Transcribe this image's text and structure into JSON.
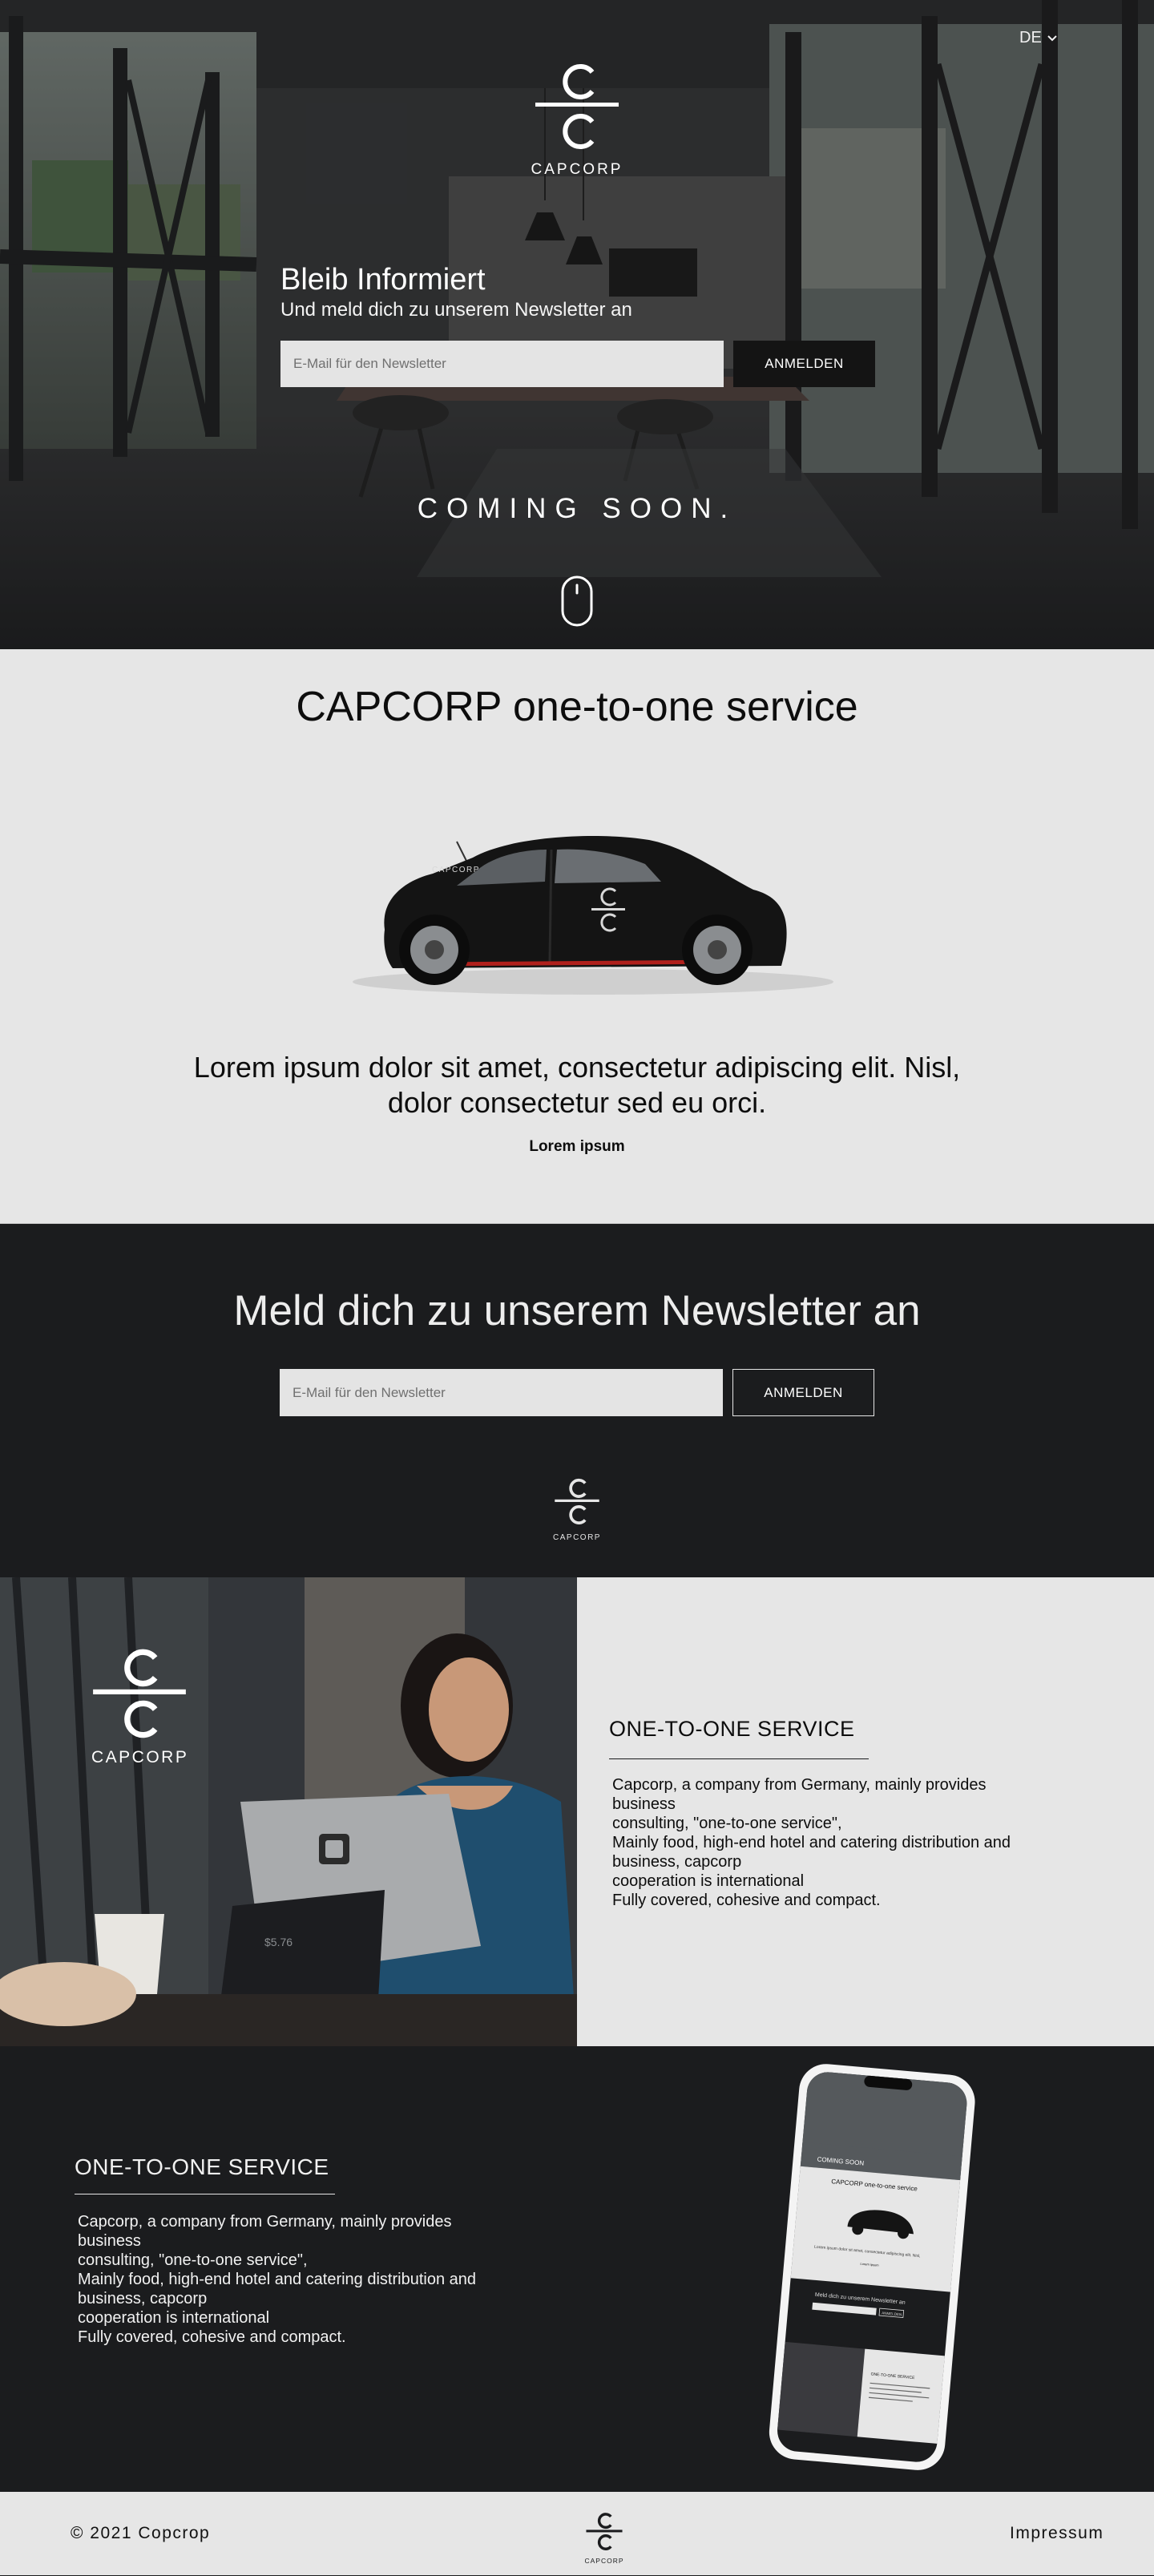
{
  "colors": {
    "dark": "#1b1c1e",
    "light": "#e6e6e6",
    "white": "#ffffff",
    "accent_red": "#b0201c"
  },
  "hero": {
    "language": "DE",
    "logo_text": "CAPCORP",
    "title": "Bleib Informiert",
    "subtitle": "Und meld dich zu unserem Newsletter an",
    "email_placeholder": "E-Mail für den Newsletter",
    "submit_label": "ANMELDEN",
    "coming_soon": "COMING SOON.",
    "scroll_icon": "mouse-icon"
  },
  "service": {
    "title": "CAPCORP one-to-one service",
    "car_label": "CAPCORP",
    "text": "Lorem ipsum dolor sit amet, consectetur adipiscing elit. Nisl, dolor consectetur sed eu orci.",
    "caption": "Lorem ipsum"
  },
  "newsletter": {
    "title": "Meld dich zu unserem Newsletter an",
    "email_placeholder": "E-Mail für den Newsletter",
    "submit_label": "ANMELDEN",
    "logo_text": "CAPCORP"
  },
  "feature_light": {
    "logo_text": "CAPCORP",
    "heading": "ONE-TO-ONE SERVICE",
    "lines": [
      "Capcorp, a company from Germany, mainly provides",
      "business",
      "consulting, \"one-to-one service\",",
      "Mainly food, high-end hotel and catering distribution and",
      "business, capcorp",
      "cooperation is international",
      "Fully covered, cohesive and compact."
    ]
  },
  "feature_dark": {
    "heading": "ONE-TO-ONE SERVICE",
    "lines": [
      "Capcorp, a company from Germany, mainly provides",
      "business",
      "consulting, \"one-to-one service\",",
      "Mainly food, high-end hotel and catering distribution and",
      "business, capcorp",
      "cooperation is international",
      "Fully covered, cohesive and compact."
    ],
    "phone_screen": {
      "coming_soon": "COMING SOON",
      "service_title": "CAPCORP one-to-one service",
      "lorem": "Lorem ipsum dolor sit amet, consectetur adipiscing elit. Nisl, dolor consectetur sed eu orci.",
      "caption": "Lorem ipsum",
      "newsletter_title": "Meld dich zu unserem Newsletter an",
      "submit_label": "ANMELDEN",
      "feature_heading": "ONE-TO-ONE SERVICE"
    }
  },
  "footer": {
    "copyright": "© 2021 Copcrop",
    "logo_text": "CAPCORP",
    "impressum": "Impressum"
  }
}
